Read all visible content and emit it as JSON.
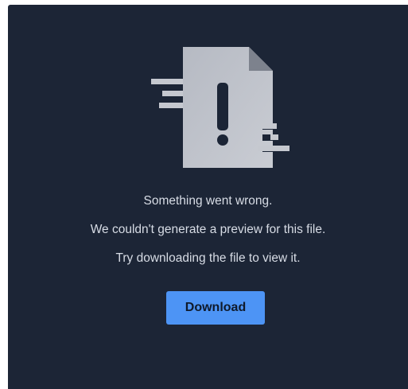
{
  "error": {
    "icon": "broken-file-icon",
    "lines": [
      "Something went wrong.",
      "We couldn't generate a preview for this file.",
      "Try downloading the file to view it."
    ]
  },
  "actions": {
    "download_label": "Download"
  },
  "colors": {
    "panel_background": "#1c2536",
    "text": "#d7dce5",
    "accent": "#4d94f5"
  }
}
